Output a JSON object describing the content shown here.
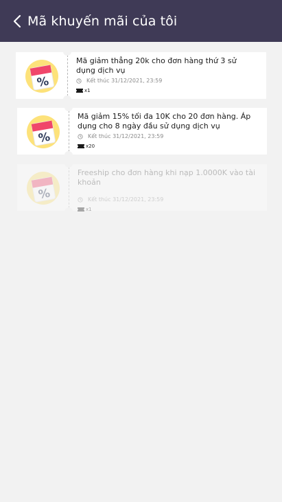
{
  "header": {
    "title": "Mã khuyến mãi của tôi",
    "background": "#3f3a56"
  },
  "coupons": [
    {
      "title": "Mã giảm thẳng 20k cho đơn hàng thứ 3 sử dụng dịch vụ",
      "expiry": "Kết thúc 31/12/2021, 23:59",
      "quantity": "x1",
      "icon": "percent-calendar-icon",
      "state": "active"
    },
    {
      "title": "Mã giảm 15% tối đa 10K cho 20 đơn hàng. Áp dụng cho 8 ngày đầu sử dụng dịch vụ",
      "expiry": "Kết thúc 31/12/2021, 23:59",
      "quantity": "x20",
      "icon": "percent-calendar-icon",
      "state": "active"
    },
    {
      "title": "Freeship cho đơn hàng khi nạp 1.0000K vào tài khoản",
      "expiry": "Kết thúc 31/12/2021, 23:59",
      "quantity": "x1",
      "icon": "percent-calendar-icon",
      "state": "disabled"
    }
  ],
  "colors": {
    "icon_circle": "#fde27a",
    "icon_tab": "#f0466a",
    "icon_card": "#ffffff",
    "icon_percent": "#2e3a59",
    "page_background": "#f2f2f2"
  }
}
